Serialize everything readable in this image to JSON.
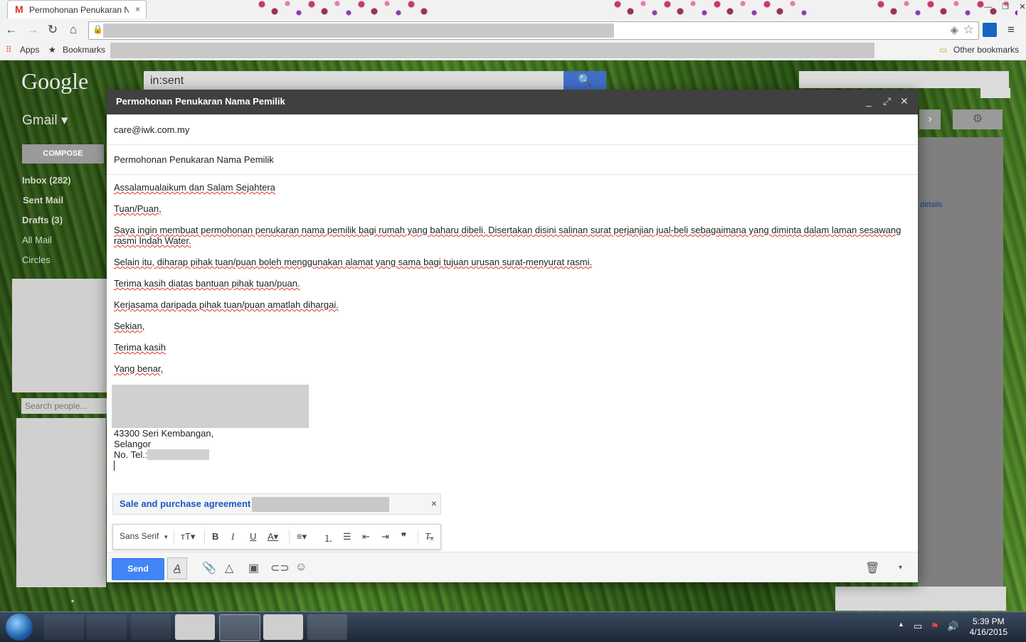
{
  "browser": {
    "tab_title": "Permohonan Penukaran N",
    "tab_close": "×",
    "apps_label": "Apps",
    "bookmarks_label": "Bookmarks",
    "other_bookmarks_label": "Other bookmarks"
  },
  "gmail": {
    "logo": "Google",
    "search_query": "in:sent",
    "app_label": "Gmail ▾",
    "compose_label": "COMPOSE",
    "nav": {
      "inbox": "Inbox (282)",
      "sent": "Sent Mail",
      "drafts": "Drafts (3)",
      "all": "All Mail",
      "circles": "Circles"
    },
    "search_people_placeholder": "Search people...",
    "details_link": "details"
  },
  "compose": {
    "title": "Permohonan Penukaran Nama Pemilik",
    "to": "care@iwk.com.my",
    "subject": "Permohonan Penukaran Nama Pemilik",
    "body": {
      "p1": "Assalamualaikum dan Salam Sejahtera",
      "p2": "Tuan/Puan,",
      "p3": "Saya ingin membuat permohonan penukaran nama pemilik bagi rumah yang baharu dibeli. Disertakan disini salinan surat perjanjian jual-beli sebagaimana yang diminta dalam laman sesawang rasmi Indah Water.",
      "p4": "Selain itu, diharap pihak tuan/puan boleh menggunakan alamat yang sama bagi tujuan urusan surat-menyurat rasmi.",
      "p5": "Terima kasih diatas bantuan pihak tuan/puan.",
      "p6": "Kerjasama daripada pihak tuan/puan amatlah dihargai.",
      "p7": "Sekian,",
      "p8": "Terima kasih",
      "p9": "Yang benar,"
    },
    "address": {
      "line1": "43300 Seri Kembangan,",
      "line2": "Selangor",
      "tel_label": "No. Tel.:"
    },
    "attachment_name": "Sale and purchase agreement",
    "attachment_close": "×",
    "font_name": "Sans Serif",
    "send_label": "Send"
  },
  "taskbar": {
    "time": "5:39 PM",
    "date": "4/16/2015"
  }
}
